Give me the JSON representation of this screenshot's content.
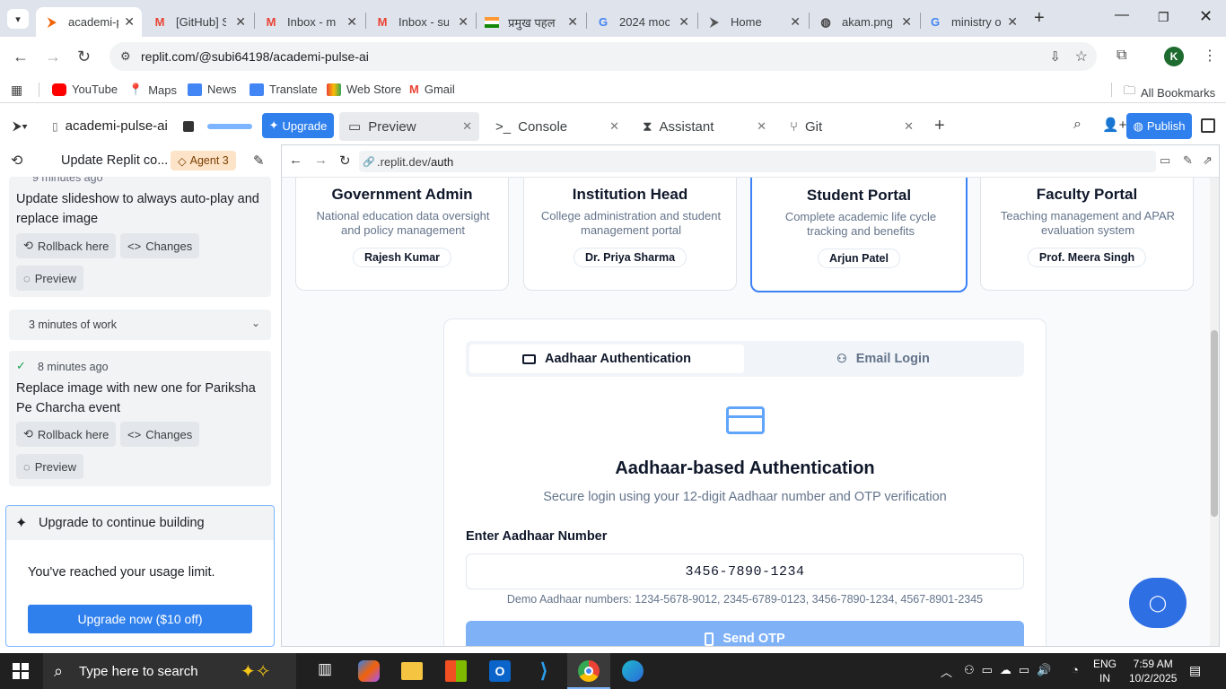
{
  "browser": {
    "tabs": [
      {
        "label": "academi-p",
        "icon": "replit-icon",
        "active": true
      },
      {
        "label": "[GitHub] S",
        "icon": "gmail-icon"
      },
      {
        "label": "Inbox - m",
        "icon": "gmail-icon"
      },
      {
        "label": "Inbox - su",
        "icon": "gmail-icon"
      },
      {
        "label": "प्रमुख पहल",
        "icon": "india-flag-icon"
      },
      {
        "label": "2024 moc",
        "icon": "google-icon"
      },
      {
        "label": "Home",
        "icon": "replit-icon"
      },
      {
        "label": "akam.png",
        "icon": "globe-icon"
      },
      {
        "label": "ministry o",
        "icon": "google-icon"
      }
    ],
    "url": "replit.com/@subi64198/academi-pulse-ai",
    "profile_initial": "K",
    "bookmarks": [
      "YouTube",
      "Maps",
      "News",
      "Translate",
      "Web Store",
      "Gmail"
    ],
    "all_bookmarks": "All Bookmarks"
  },
  "replit": {
    "project": "academi-pulse-ai",
    "upgrade": "Upgrade",
    "tabs": [
      "Preview",
      "Console",
      "Assistant",
      "Git"
    ],
    "publish": "Publish",
    "panel_title": "Update Replit co...",
    "agent_badge": "Agent 3"
  },
  "chat": {
    "top_time": "9 minutes ago",
    "items": [
      {
        "text": "Update slideshow to always auto-play and replace image",
        "rollback": "Rollback here",
        "changes": "Changes",
        "preview": "Preview"
      },
      {
        "time": "8 minutes ago",
        "text": "Replace image with new one for Pariksha Pe Charcha event",
        "rollback": "Rollback here",
        "changes": "Changes",
        "preview": "Preview"
      }
    ],
    "work": "3 minutes of work",
    "upgrade_title": "Upgrade to continue building",
    "limit_text": "You've reached your usage limit.",
    "upgrade_button": "Upgrade now ($10 off)"
  },
  "preview": {
    "url_prefix": ".replit.dev/",
    "url_path": "auth",
    "roles": [
      {
        "title": "Government Admin",
        "desc": "National education data oversight and policy management",
        "name": "Rajesh Kumar",
        "color": "#ef4444"
      },
      {
        "title": "Institution Head",
        "desc": "College administration and student management portal",
        "name": "Dr. Priya Sharma",
        "color": "#3b82f6"
      },
      {
        "title": "Student Portal",
        "desc": "Complete academic life cycle tracking and benefits",
        "name": "Arjun Patel",
        "color": "#22c55e",
        "selected": true
      },
      {
        "title": "Faculty Portal",
        "desc": "Teaching management and APAR evaluation system",
        "name": "Prof. Meera Singh",
        "color": "#a855f7"
      }
    ],
    "auth": {
      "tab_aadhaar": "Aadhaar Authentication",
      "tab_email": "Email Login",
      "heading": "Aadhaar-based Authentication",
      "subheading": "Secure login using your 12-digit Aadhaar number and OTP verification",
      "field_label": "Enter Aadhaar Number",
      "field_value": "3456-7890-1234",
      "demo": "Demo Aadhaar numbers: 1234-5678-9012, 2345-6789-0123, 3456-7890-1234, 4567-8901-2345",
      "send_otp": "Send OTP"
    }
  },
  "taskbar": {
    "search_placeholder": "Type here to search",
    "lang1": "ENG",
    "lang2": "IN",
    "time": "7:59 AM",
    "date": "10/2/2025"
  }
}
